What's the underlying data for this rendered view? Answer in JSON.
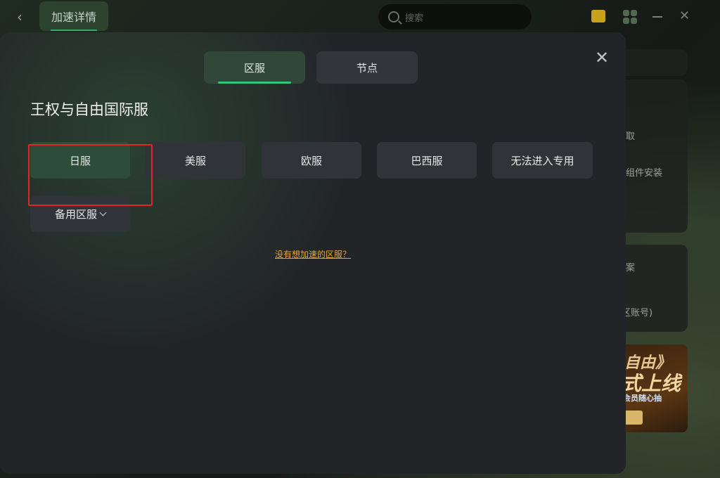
{
  "background": {
    "top_tab": "加速详情",
    "search_placeholder": "搜索",
    "side_texts": [
      "取",
      "组件安装",
      "案",
      "区账号)"
    ],
    "banner": {
      "line1": "自由》",
      "line2": "式上线",
      "line3": "会员随心抽"
    }
  },
  "modal": {
    "tabs": [
      {
        "label": "区服",
        "active": true
      },
      {
        "label": "节点",
        "active": false
      }
    ],
    "game_title": "王权与自由国际服",
    "regions": [
      {
        "label": "日服",
        "selected": true
      },
      {
        "label": "美服",
        "selected": false
      },
      {
        "label": "欧服",
        "selected": false
      },
      {
        "label": "巴西服",
        "selected": false
      },
      {
        "label": "无法进入专用",
        "selected": false
      }
    ],
    "backup_label": "备用区服",
    "missing_link": "没有想加速的区服？"
  },
  "colors": {
    "accent": "#36c67a",
    "link": "#e8a332",
    "highlight_box": "#e02626"
  }
}
